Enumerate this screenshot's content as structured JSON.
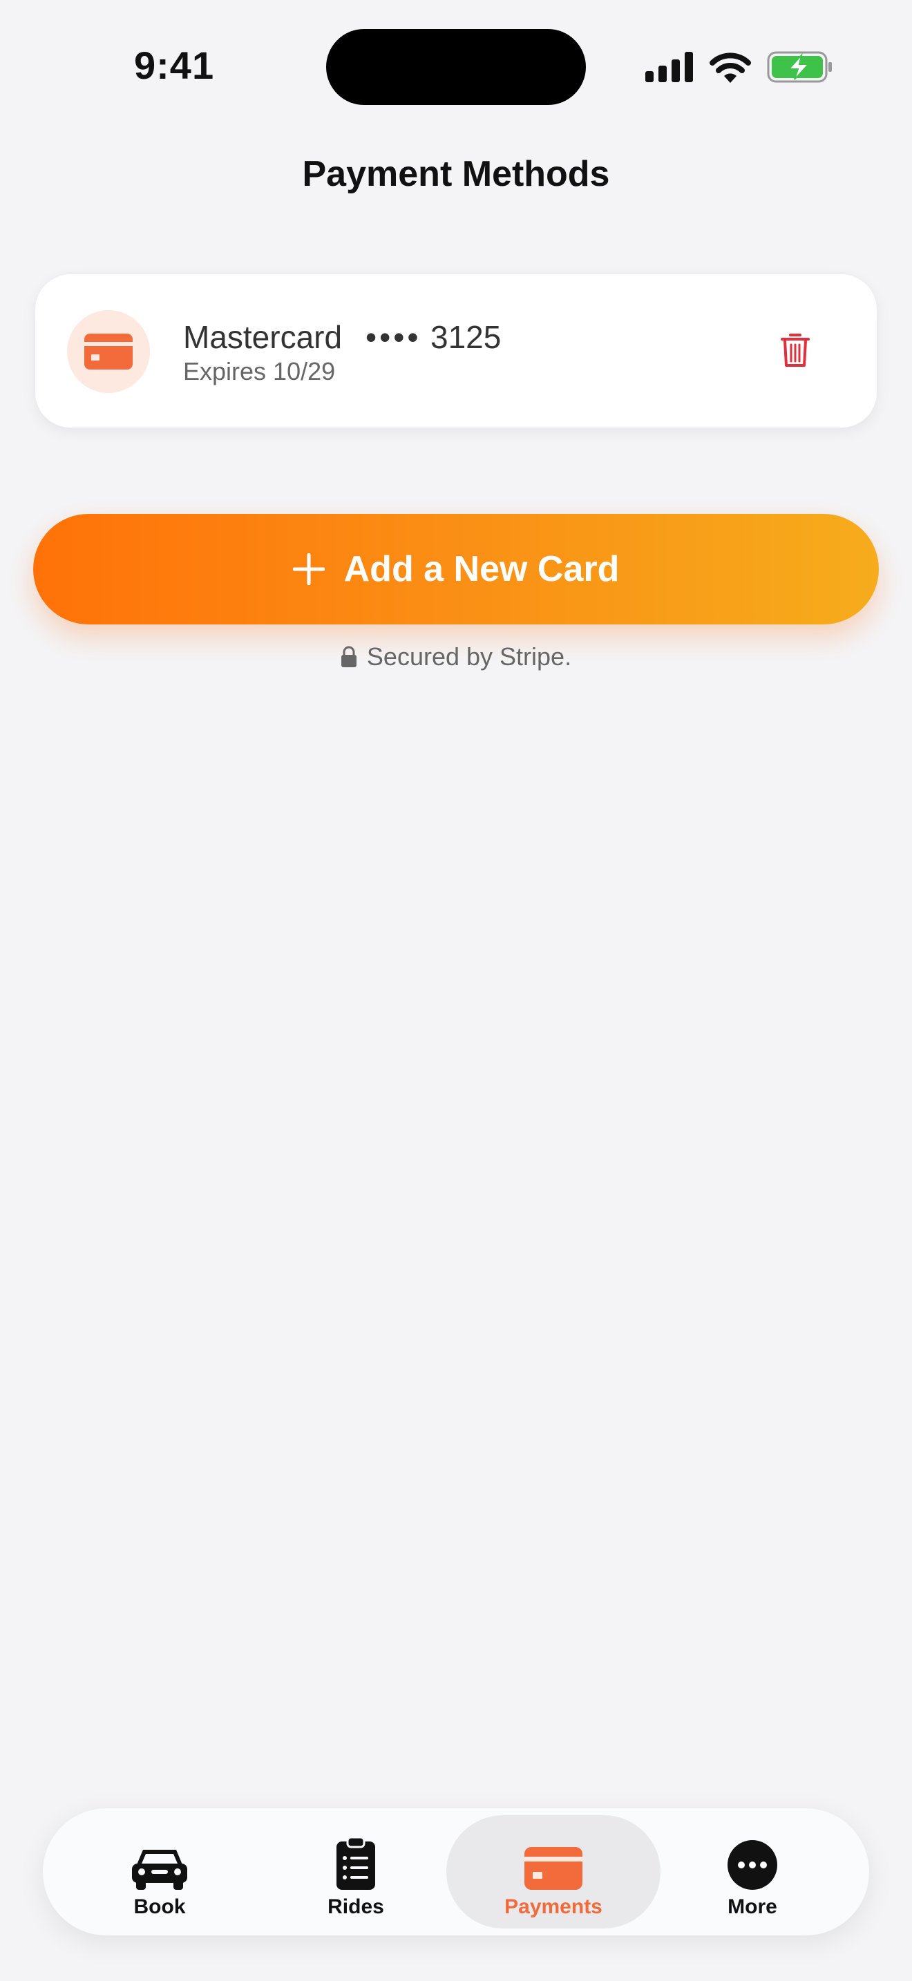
{
  "status_bar": {
    "time": "9:41"
  },
  "header": {
    "title": "Payment Methods"
  },
  "cards": [
    {
      "brand": "Mastercard",
      "masked": "••••",
      "last4": "3125",
      "expiry": "Expires 10/29"
    }
  ],
  "actions": {
    "add_card_label": "Add a New Card",
    "secured_text": "Secured by Stripe."
  },
  "tab_bar": {
    "tabs": [
      {
        "label": "Book",
        "icon": "car-icon",
        "active": false
      },
      {
        "label": "Rides",
        "icon": "clipboard-icon",
        "active": false
      },
      {
        "label": "Payments",
        "icon": "card-icon",
        "active": true
      },
      {
        "label": "More",
        "icon": "ellipsis-icon",
        "active": false
      }
    ]
  },
  "colors": {
    "accent": "#f06a3a",
    "gradient_start": "#ff7208",
    "gradient_end": "#f6ac1c",
    "danger": "#e0303c",
    "background": "#f4f4f6"
  }
}
